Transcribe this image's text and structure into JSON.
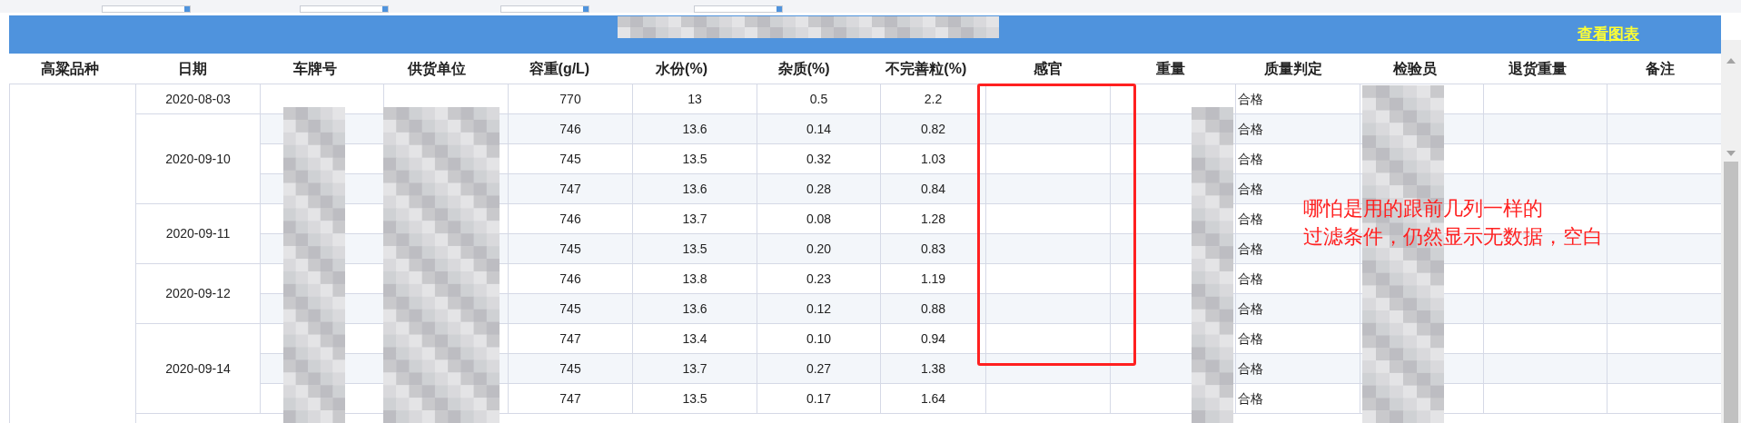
{
  "filter_fields": [
    {
      "kind": "dropdown"
    },
    {
      "kind": "dropdown"
    },
    {
      "kind": "dropdown"
    },
    {
      "kind": "dropdown"
    }
  ],
  "toolbar": {
    "chart_link": "查看图表"
  },
  "table": {
    "columns": [
      "高粱品种",
      "日期",
      "车牌号",
      "供货单位",
      "容重(g/L)",
      "水份(%)",
      "杂质(%)",
      "不完善粒(%)",
      "感官",
      "重量",
      "质量判定",
      "检验员",
      "退货重量",
      "备注"
    ],
    "groups": [
      {
        "date": "2020-08-03",
        "rows": [
          {
            "volume_weight": "770",
            "moisture": "13",
            "impurity": "0.5",
            "imperfect": "2.2",
            "quality": "合格"
          }
        ]
      },
      {
        "date": "2020-09-10",
        "rows": [
          {
            "volume_weight": "746",
            "moisture": "13.6",
            "impurity": "0.14",
            "imperfect": "0.82",
            "quality": "合格"
          },
          {
            "volume_weight": "745",
            "moisture": "13.5",
            "impurity": "0.32",
            "imperfect": "1.03",
            "quality": "合格"
          },
          {
            "volume_weight": "747",
            "moisture": "13.6",
            "impurity": "0.28",
            "imperfect": "0.84",
            "quality": "合格"
          }
        ]
      },
      {
        "date": "2020-09-11",
        "rows": [
          {
            "volume_weight": "746",
            "moisture": "13.7",
            "impurity": "0.08",
            "imperfect": "1.28",
            "quality": "合格"
          },
          {
            "volume_weight": "745",
            "moisture": "13.5",
            "impurity": "0.20",
            "imperfect": "0.83",
            "quality": "合格"
          }
        ]
      },
      {
        "date": "2020-09-12",
        "rows": [
          {
            "volume_weight": "746",
            "moisture": "13.8",
            "impurity": "0.23",
            "imperfect": "1.19",
            "quality": "合格"
          },
          {
            "volume_weight": "745",
            "moisture": "13.6",
            "impurity": "0.12",
            "imperfect": "0.88",
            "quality": "合格"
          }
        ]
      },
      {
        "date": "2020-09-14",
        "rows": [
          {
            "volume_weight": "747",
            "moisture": "13.4",
            "impurity": "0.10",
            "imperfect": "0.94",
            "quality": "合格"
          },
          {
            "volume_weight": "745",
            "moisture": "13.7",
            "impurity": "0.27",
            "imperfect": "1.38",
            "quality": "合格"
          },
          {
            "volume_weight": "747",
            "moisture": "13.5",
            "impurity": "0.17",
            "imperfect": "1.64",
            "quality": "合格"
          }
        ]
      }
    ]
  },
  "annotation": {
    "lines": [
      "哪怕是用的跟前几列一样的",
      "过滤条件，仍然显示无数据，空白"
    ]
  }
}
